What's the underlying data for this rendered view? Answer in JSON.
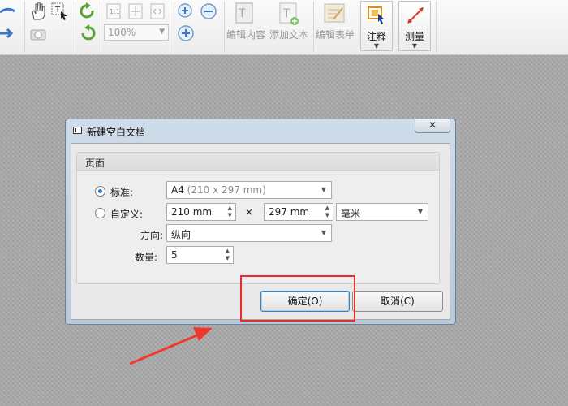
{
  "toolbar": {
    "zoom_value": "100%",
    "edit_content_label": "编辑内容",
    "add_text_label": "添加文本",
    "edit_form_label": "编辑表单",
    "annotate_label": "注释",
    "measure_label": "测量"
  },
  "dialog": {
    "title": "新建空白文档",
    "group_title": "页面",
    "standard_label": "标准:",
    "standard_selected": true,
    "standard_value_main": "A4",
    "standard_value_sub": "(210 x 297 mm)",
    "custom_label": "自定义:",
    "custom_selected": false,
    "width_value": "210 mm",
    "times_symbol": "×",
    "height_value": "297 mm",
    "unit_value": "毫米",
    "orientation_label": "方向:",
    "orientation_value": "纵向",
    "quantity_label": "数量:",
    "quantity_value": "5",
    "ok_label": "确定(O)",
    "cancel_label": "取消(C)"
  },
  "colors": {
    "highlight": "#ee2b2b",
    "arrow": "#ee3a2e",
    "radio_dot": "#2a6fd6"
  },
  "icons": [
    "hand-icon",
    "select-text-icon",
    "rotate-cw-icon",
    "rotate-ccw-icon",
    "actual-size-icon",
    "fit-page-icon",
    "fit-width-icon",
    "zoom-in-icon",
    "zoom-out-icon",
    "camera-icon",
    "edit-content-icon",
    "add-text-icon",
    "edit-form-icon",
    "annotate-icon",
    "measure-icon"
  ]
}
